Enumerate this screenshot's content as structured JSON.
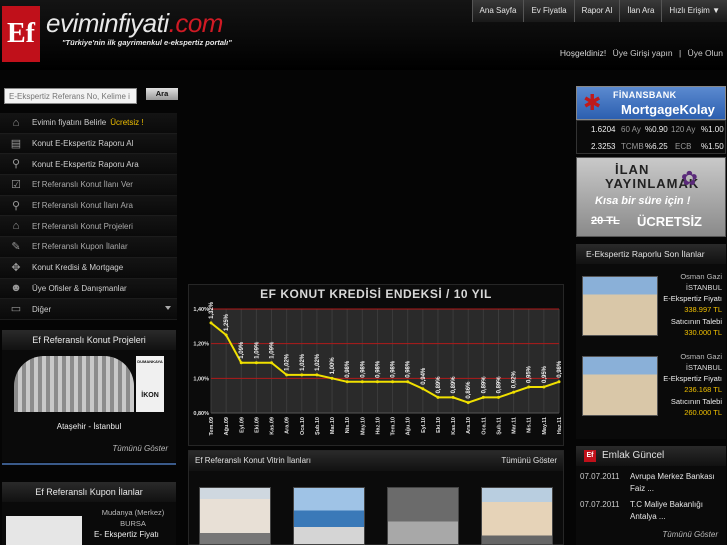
{
  "header": {
    "logo_mark": "Ef",
    "logo_name": "eviminfiyati",
    "logo_dot": ".com",
    "tagline": "\"Türkiye'nin ilk gayrimenkul e-ekspertiz portalı\""
  },
  "topnav": [
    "Ana Sayfa",
    "Ev Fiyatla",
    "Rapor Al",
    "İlan Ara",
    "Hızlı Erişim ▼"
  ],
  "welcome": {
    "greeting": "Hoşgeldiniz!",
    "login": "Üye Girişi yapın",
    "sep": "|",
    "register": "Üye Olun"
  },
  "search": {
    "placeholder": "E-Ekspertiz Referans No, Kelime i",
    "button": "Ara"
  },
  "menu": [
    {
      "label": "Evimin fiyatını Belirle",
      "highlight": "Ücretsiz !",
      "icon": "house-icon"
    },
    {
      "label": "Konut E-Ekspertiz Raporu Al",
      "icon": "document-icon"
    },
    {
      "label": "Konut E-Ekspertiz Raporu Ara",
      "icon": "magnifier-icon"
    },
    {
      "label": "Ef Referanslı Konut İlanı Ver",
      "icon": "checklist-icon"
    },
    {
      "label": "Ef Referanslı Konut İlanı Ara",
      "icon": "magnifier-icon"
    },
    {
      "label": "Ef Referanslı Konut Projeleri",
      "icon": "houses-icon"
    },
    {
      "label": "Ef Referanslı Kupon İlanlar",
      "icon": "tag-icon"
    },
    {
      "label": "Konut Kredisi & Mortgage",
      "icon": "handshake-icon"
    },
    {
      "label": "Üye Ofisler & Danışmanlar",
      "icon": "people-icon"
    },
    {
      "label": "Diğer",
      "icon": "folder-icon"
    }
  ],
  "projects": {
    "title": "Ef Referanslı Konut Projeleri",
    "logo_top": "DUMANKAYA",
    "logo": "İKON",
    "location": "Ataşehir - İstanbul",
    "more": "Tümünü Göster"
  },
  "coupons": {
    "title": "Ef Referanslı Kupon İlanlar",
    "loc1": "Mudanya (Merkez)",
    "loc2": "BURSA",
    "label": "E- Ekspertiz Fiyatı"
  },
  "chart_data": {
    "type": "line",
    "title": "EF KONUT KREDİSİ ENDEKSİ / 10 YIL",
    "categories": [
      "Tem.09",
      "Ağu.09",
      "Eyl.09",
      "Eki.09",
      "Kas.09",
      "Ara.09",
      "Oca.10",
      "Şub.10",
      "Mar.10",
      "Nis.10",
      "May.10",
      "Haz.10",
      "Tem.10",
      "Ağu.10",
      "Eyl.10",
      "Eki.10",
      "Kas.10",
      "Ara.10",
      "Oca.11",
      "Şub.11",
      "Mar.11",
      "Nis.11",
      "May.11",
      "Haz.11"
    ],
    "values": [
      1.32,
      1.25,
      1.09,
      1.09,
      1.09,
      1.02,
      1.02,
      1.02,
      1.0,
      0.98,
      0.98,
      0.98,
      0.98,
      0.98,
      0.94,
      0.89,
      0.89,
      0.86,
      0.89,
      0.89,
      0.92,
      0.95,
      0.95,
      0.98
    ],
    "value_labels": [
      "1,32%",
      "1,25%",
      "1,09%",
      "1,09%",
      "1,09%",
      "1,02%",
      "1,02%",
      "1,02%",
      "1,00%",
      "0,98%",
      "0,98%",
      "0,98%",
      "0,98%",
      "0,98%",
      "0,94%",
      "0,89%",
      "0,89%",
      "0,86%",
      "0,89%",
      "0,89%",
      "0,92%",
      "0,95%",
      "0,95%",
      "0,98%"
    ],
    "yticks": [
      "1,40%",
      "1,20%",
      "1,00%",
      "0,80%"
    ],
    "ylim": [
      0.8,
      1.4
    ],
    "line_color": "#f0e000",
    "grid": true
  },
  "vitrin": {
    "title": "Ef Referanslı Konut Vitrin İlanları",
    "more": "Tümünü Göster"
  },
  "bank": {
    "name": "FİNANSBANK",
    "product": "MortgageKolay"
  },
  "rates": [
    {
      "value": "1.6204",
      "t1": "60 Ay",
      "v1": "%0.90",
      "t2": "120 Ay",
      "v2": "%1.00"
    },
    {
      "value": "2.3253",
      "t1": "TCMB",
      "v1": "%6.25",
      "t2": "ECB",
      "v2": "%1.50"
    }
  ],
  "promo": {
    "l1": "İLAN",
    "l2": "YAYINLAMAK",
    "l3": "Kısa bir süre için !",
    "l4": "20 TL",
    "l5": "ÜCRETSİZ"
  },
  "listings": {
    "title": "E-Ekspertiz Raporlu Son İlanlar",
    "items": [
      {
        "district": "Osman Gazi",
        "city": "İSTANBUL",
        "label1": "E-Ekspertiz Fiyatı",
        "price1": "338.997 TL",
        "label2": "Satıcının Talebi",
        "price2": "330.000 TL"
      },
      {
        "district": "Osman Gazi",
        "city": "İSTANBUL",
        "label1": "E-Ekspertiz Fiyatı",
        "price1": "236.168 TL",
        "label2": "Satıcının Talebi",
        "price2": "260.000 TL"
      }
    ]
  },
  "emlak": {
    "title": "Emlak Güncel",
    "news": [
      {
        "date": "07.07.2011",
        "line1": "Avrupa Merkez Bankası",
        "line2": "Faiz ..."
      },
      {
        "date": "07.07.2011",
        "line1": "T.C Maliye Bakanlığı",
        "line2": "Antalya ..."
      }
    ],
    "more": "Tümünü Göster"
  },
  "colors": {
    "brand_red": "#c0101a",
    "highlight": "#f0c000",
    "price": "#f0c000"
  }
}
